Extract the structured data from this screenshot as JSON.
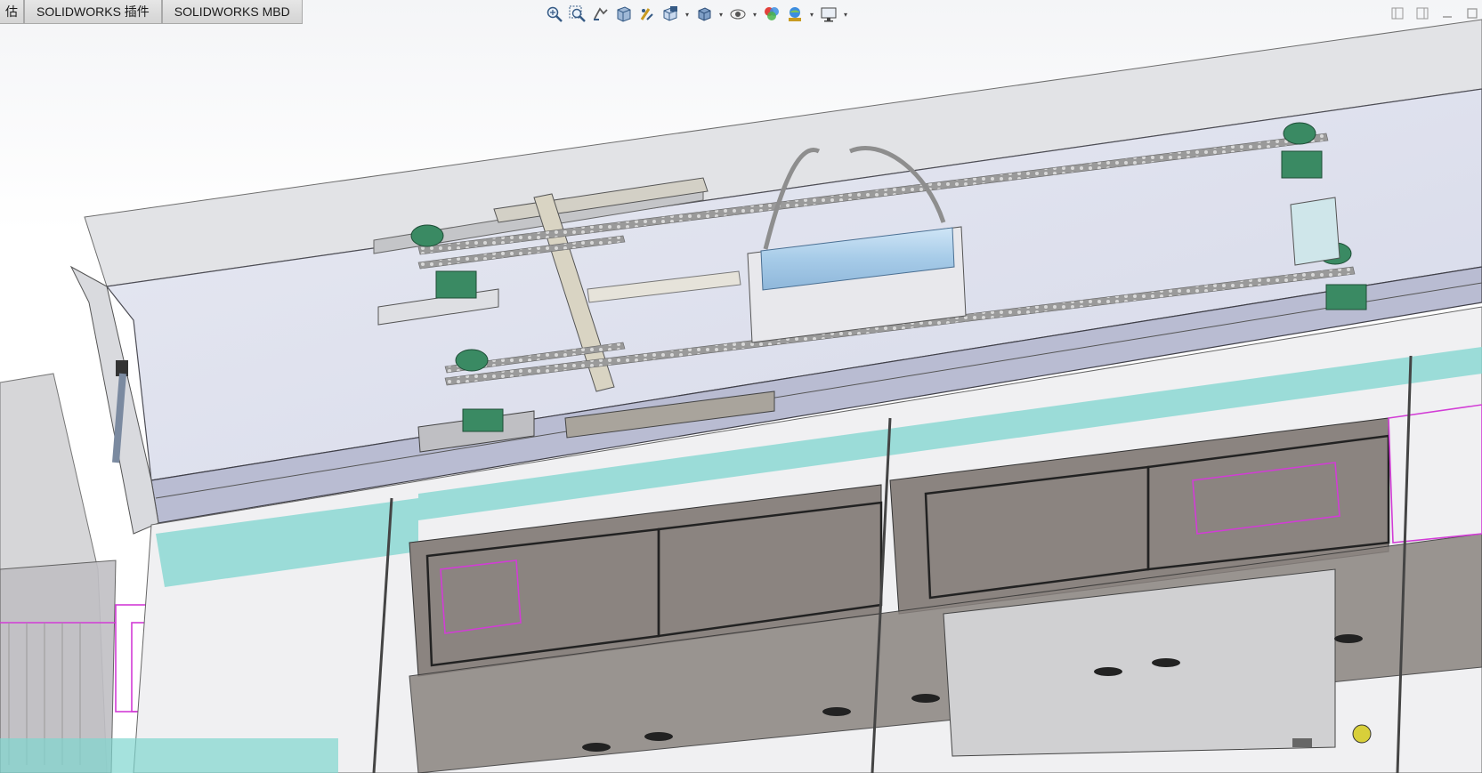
{
  "tabs": [
    {
      "id": "evaluate",
      "label": "估"
    },
    {
      "id": "addins",
      "label": "SOLIDWORKS 插件"
    },
    {
      "id": "mbd",
      "label": "SOLIDWORKS MBD"
    }
  ],
  "heads_up_toolbar": [
    {
      "name": "zoom-to-fit-icon"
    },
    {
      "name": "zoom-to-area-icon"
    },
    {
      "name": "previous-view-icon"
    },
    {
      "name": "section-view-icon"
    },
    {
      "name": "dynamic-annotation-view-icon"
    },
    {
      "name": "view-orientation-icon",
      "dropdown": true
    },
    {
      "name": "display-style-icon",
      "dropdown": true
    },
    {
      "name": "hide-show-items-icon",
      "dropdown": true
    },
    {
      "name": "edit-appearance-icon"
    },
    {
      "name": "apply-scene-icon",
      "dropdown": true
    },
    {
      "name": "view-settings-icon",
      "dropdown": true
    }
  ],
  "window_controls": [
    {
      "name": "restore-pane-left-icon"
    },
    {
      "name": "restore-pane-right-icon"
    },
    {
      "name": "minimize-icon"
    },
    {
      "name": "maximize-icon"
    }
  ],
  "colors": {
    "chain": "#8a8a8a",
    "bearing": "#3a8a63",
    "cylinder": "#a9cde8",
    "glass_blue": "#d7dcef",
    "teal_trim": "#7fd6cf",
    "magenta_lines": "#d23cd6",
    "tank_fill": "#8b8480"
  }
}
